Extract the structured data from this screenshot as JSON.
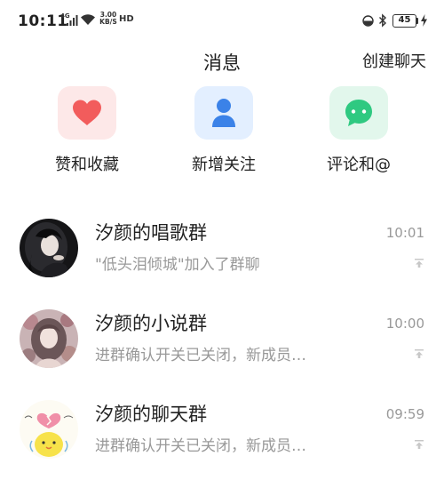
{
  "status_bar": {
    "time": "10:11",
    "network": "4G",
    "speed_value": "3.00",
    "speed_unit": "KB/S",
    "hd": "HD",
    "battery": "45"
  },
  "header": {
    "title": "消息",
    "create_chat": "创建聊天"
  },
  "quick_actions": [
    {
      "label": "赞和收藏",
      "icon": "heart-icon",
      "color": "#f25c5c",
      "bg": "#fde8e8"
    },
    {
      "label": "新增关注",
      "icon": "person-icon",
      "color": "#3b82e8",
      "bg": "#e3efff"
    },
    {
      "label": "评论和@",
      "icon": "chat-bubble-icon",
      "color": "#2fc981",
      "bg": "#e2f7ec"
    }
  ],
  "chats": [
    {
      "name": "汐颜的唱歌群",
      "time": "10:01",
      "preview": "\"低头泪倾城\"加入了群聊"
    },
    {
      "name": "汐颜的小说群",
      "time": "10:00",
      "preview": "进群确认开关已关闭，新成员…"
    },
    {
      "name": "汐颜的聊天群",
      "time": "09:59",
      "preview": "进群确认开关已关闭，新成员…"
    }
  ]
}
